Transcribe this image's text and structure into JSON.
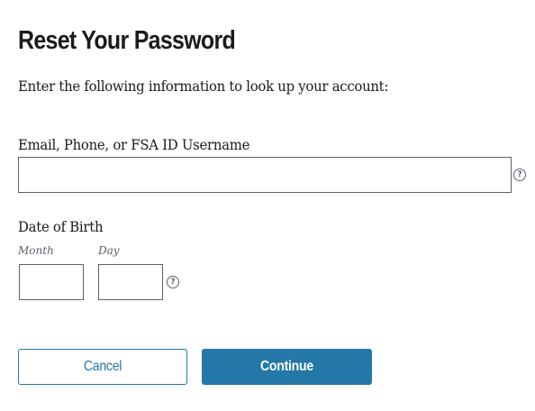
{
  "page": {
    "title": "Reset Your Password",
    "instructions": "Enter the following information to look up your account:"
  },
  "form": {
    "identifier": {
      "label": "Email, Phone, or FSA ID Username",
      "value": "",
      "help_icon": "question-circle-icon",
      "help_glyph": "?"
    },
    "dob": {
      "label": "Date of Birth",
      "month_label": "Month",
      "month_value": "",
      "day_label": "Day",
      "day_value": "",
      "help_icon": "question-circle-icon",
      "help_glyph": "?"
    }
  },
  "actions": {
    "cancel_label": "Cancel",
    "continue_label": "Continue"
  },
  "colors": {
    "primary": "#2378a8",
    "text": "#1b1b1b",
    "border": "#5b616b"
  }
}
